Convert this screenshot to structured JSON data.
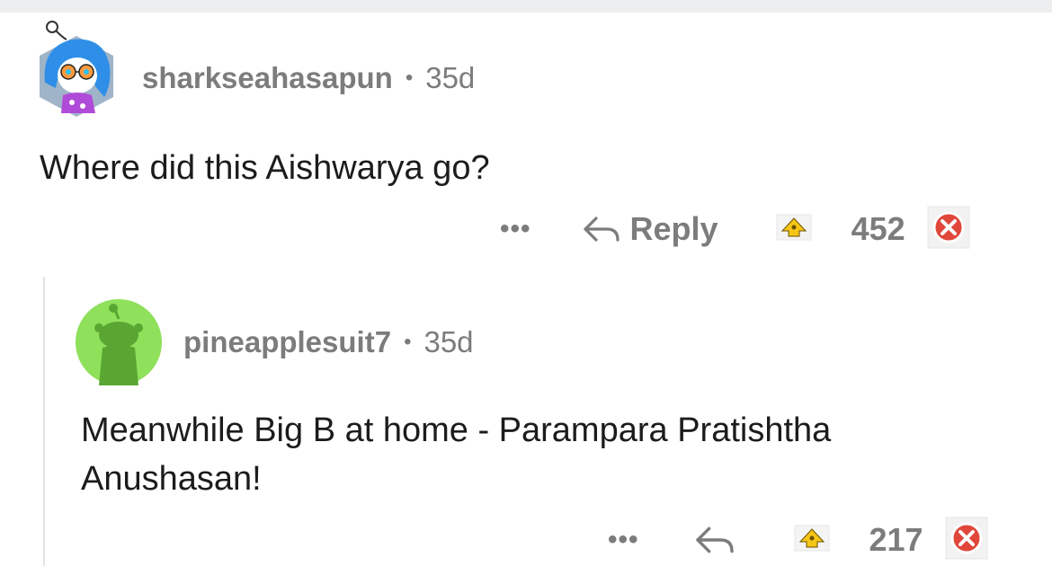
{
  "comments": [
    {
      "username": "sharkseahasapun",
      "separator": "•",
      "age": "35d",
      "text": "Where did this Aishwarya go?",
      "actions": {
        "more_label": "•••",
        "reply_label": "Reply",
        "score": "452"
      }
    },
    {
      "username": "pineapplesuit7",
      "separator": "•",
      "age": "35d",
      "text_line1": "Meanwhile Big B at home - Parampara Pratishtha",
      "text_line2": "Anushasan!",
      "actions": {
        "more_label": "•••",
        "score": "217"
      }
    }
  ],
  "colors": {
    "meta_text": "#7c7c7c",
    "body_text": "#1c1c1c",
    "upvote_award": "#f5c518",
    "downvote_award": "#e0463a",
    "avatar2_bg": "#8fe05b",
    "avatar2_snoo": "#5aa632"
  },
  "icons": {
    "avatar1": "anime-avatar-blue-hair-icon",
    "avatar2": "snoo-avatar-icon",
    "reply": "reply-arrow-icon",
    "upvote": "upvote-award-icon",
    "downvote": "downvote-award-icon"
  }
}
